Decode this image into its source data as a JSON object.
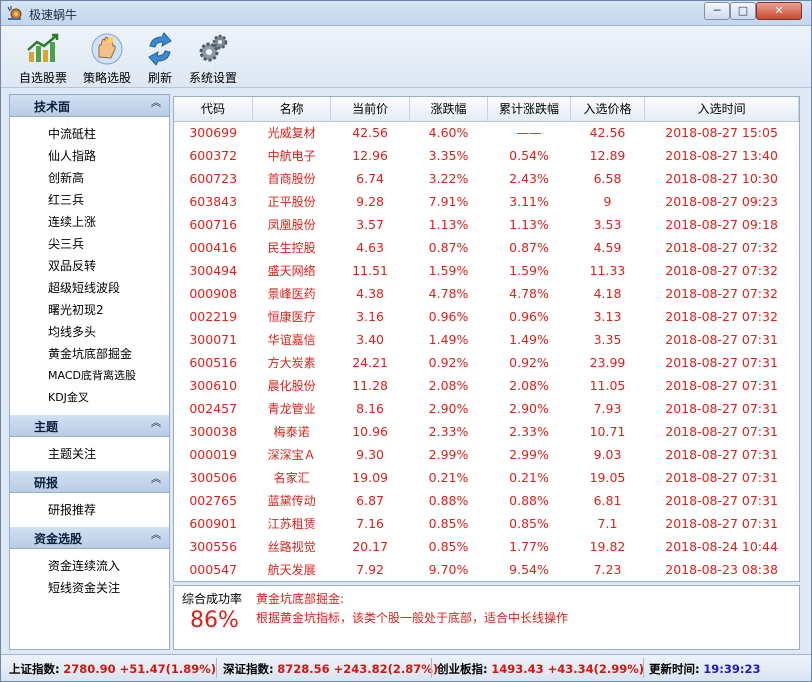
{
  "window": {
    "title": "极速蜗牛",
    "min_glyph": "─",
    "max_glyph": "□",
    "close_glyph": "✕"
  },
  "toolbar": [
    {
      "label": "自选股票",
      "icon": "chart-icon"
    },
    {
      "label": "策略选股",
      "icon": "strategy-hand-icon"
    },
    {
      "label": "刷新",
      "icon": "refresh-icon"
    },
    {
      "label": "系统设置",
      "icon": "gears-icon"
    }
  ],
  "sidebar": {
    "chevron_glyph": "︽",
    "sections": [
      {
        "title": "技术面",
        "items": [
          "中流砥柱",
          "仙人指路",
          "创新高",
          "红三兵",
          "连续上涨",
          "尖三兵",
          "双品反转",
          "超级短线波段",
          "曙光初现2",
          "均线多头",
          "黄金坑底部掘金",
          "MACD底背离选股",
          "KDJ金叉"
        ]
      },
      {
        "title": "主题",
        "items": [
          "主题关注"
        ]
      },
      {
        "title": "研报",
        "items": [
          "研报推荐"
        ]
      },
      {
        "title": "资金选股",
        "items": [
          "资金连续流入",
          "短线资金关注"
        ]
      }
    ]
  },
  "table": {
    "columns": [
      "代码",
      "名称",
      "当前价",
      "涨跌幅",
      "累计涨跌幅",
      "入选价格",
      "入选时间"
    ],
    "rows": [
      [
        "300699",
        "光威复材",
        "42.56",
        "4.60%",
        "——",
        "42.56",
        "2018-08-27 15:05"
      ],
      [
        "600372",
        "中航电子",
        "12.96",
        "3.35%",
        "0.54%",
        "12.89",
        "2018-08-27 13:40"
      ],
      [
        "600723",
        "首商股份",
        "6.74",
        "3.22%",
        "2.43%",
        "6.58",
        "2018-08-27 10:30"
      ],
      [
        "603843",
        "正平股份",
        "9.28",
        "7.91%",
        "3.11%",
        "9",
        "2018-08-27 09:23"
      ],
      [
        "600716",
        "凤凰股份",
        "3.57",
        "1.13%",
        "1.13%",
        "3.53",
        "2018-08-27 09:18"
      ],
      [
        "000416",
        "民生控股",
        "4.63",
        "0.87%",
        "0.87%",
        "4.59",
        "2018-08-27 07:32"
      ],
      [
        "300494",
        "盛天网络",
        "11.51",
        "1.59%",
        "1.59%",
        "11.33",
        "2018-08-27 07:32"
      ],
      [
        "000908",
        "景峰医药",
        "4.38",
        "4.78%",
        "4.78%",
        "4.18",
        "2018-08-27 07:32"
      ],
      [
        "002219",
        "恒康医疗",
        "3.16",
        "0.96%",
        "0.96%",
        "3.13",
        "2018-08-27 07:32"
      ],
      [
        "300071",
        "华谊嘉信",
        "3.40",
        "1.49%",
        "1.49%",
        "3.35",
        "2018-08-27 07:31"
      ],
      [
        "600516",
        "方大炭素",
        "24.21",
        "0.92%",
        "0.92%",
        "23.99",
        "2018-08-27 07:31"
      ],
      [
        "300610",
        "晨化股份",
        "11.28",
        "2.08%",
        "2.08%",
        "11.05",
        "2018-08-27 07:31"
      ],
      [
        "002457",
        "青龙管业",
        "8.16",
        "2.90%",
        "2.90%",
        "7.93",
        "2018-08-27 07:31"
      ],
      [
        "300038",
        "梅泰诺",
        "10.96",
        "2.33%",
        "2.33%",
        "10.71",
        "2018-08-27 07:31"
      ],
      [
        "000019",
        "深深宝Ａ",
        "9.30",
        "2.99%",
        "2.99%",
        "9.03",
        "2018-08-27 07:31"
      ],
      [
        "300506",
        "名家汇",
        "19.09",
        "0.21%",
        "0.21%",
        "19.05",
        "2018-08-27 07:31"
      ],
      [
        "002765",
        "蓝黛传动",
        "6.87",
        "0.88%",
        "0.88%",
        "6.81",
        "2018-08-27 07:31"
      ],
      [
        "600901",
        "江苏租赁",
        "7.16",
        "0.85%",
        "0.85%",
        "7.1",
        "2018-08-27 07:31"
      ],
      [
        "300556",
        "丝路视觉",
        "20.17",
        "0.85%",
        "1.77%",
        "19.82",
        "2018-08-24 10:44"
      ],
      [
        "000547",
        "航天发展",
        "7.92",
        "9.70%",
        "9.54%",
        "7.23",
        "2018-08-23 08:38"
      ]
    ]
  },
  "info": {
    "label": "综合成功率",
    "percent": "86%",
    "strategy_title": "黄金坑底部掘金:",
    "description": "根据黄金坑指标，该类个股一般处于底部，适合中长线操作"
  },
  "statusbar": {
    "sh_label": "上证指数:",
    "sh_value": "2780.90 +51.47(1.89%)",
    "sz_label": "深证指数:",
    "sz_value": "8728.56 +243.82(2.87%)",
    "cy_label": "创业板指:",
    "cy_value": "1493.43 +43.34(2.99%)",
    "time_label": "更新时间:",
    "time_value": "19:39:23"
  },
  "colors": {
    "red": "#e0201a",
    "time_blue": "#1a1acc",
    "panel": "#dfe9f5"
  }
}
